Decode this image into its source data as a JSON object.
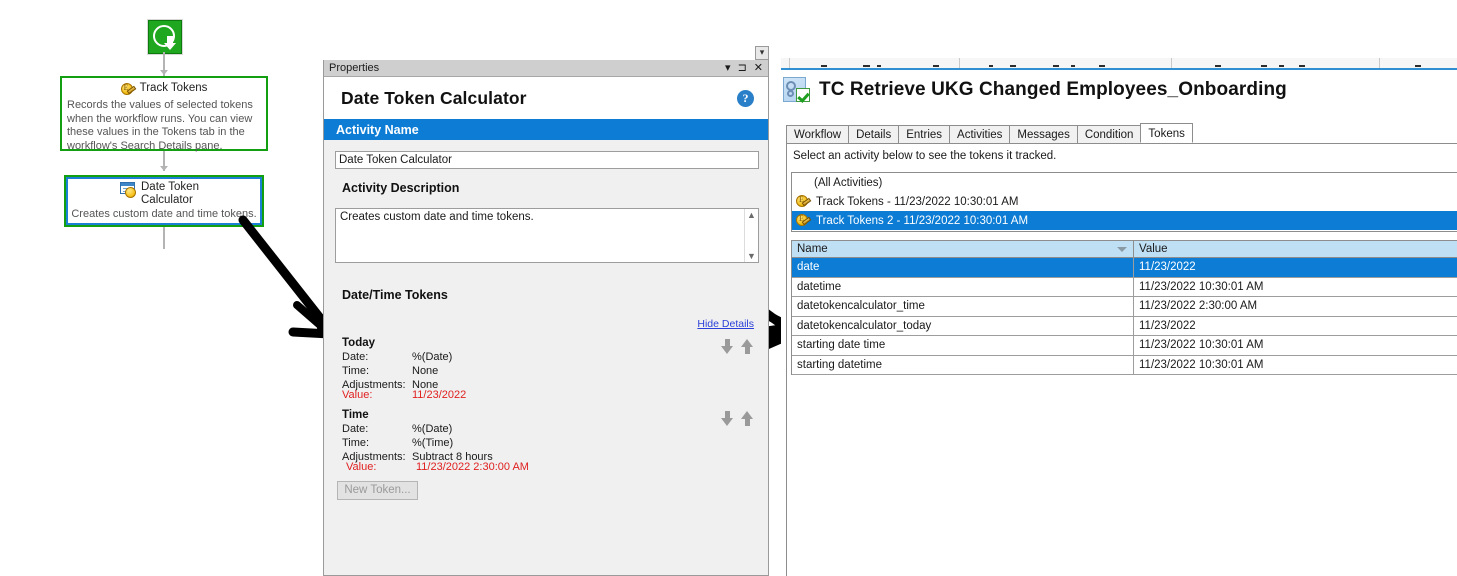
{
  "workflow": {
    "start_icon": "download-arrow-icon",
    "nodes": [
      {
        "icon": "track-tokens-icon",
        "title": "Track Tokens",
        "description": "Records the values of selected tokens when the workflow runs. You can view these values in the Tokens tab in the workflow's Search Details pane.",
        "selected": false
      },
      {
        "icon": "date-token-calculator-icon",
        "title": "Date Token\nCalculator",
        "title_line1": "Date Token",
        "title_line2": "Calculator",
        "description": "Creates custom date and time tokens.",
        "selected": true
      }
    ]
  },
  "properties": {
    "panel_title": "Properties",
    "titlebar_buttons": [
      "dropdown",
      "pin",
      "close"
    ],
    "heading": "Date Token Calculator",
    "help_icon": "help-circle-icon",
    "section_activity_name": "Activity Name",
    "activity_name_value": "Date Token Calculator",
    "section_activity_description": "Activity Description",
    "activity_description_value": "Creates custom date and time tokens.",
    "section_datetime_tokens": "Date/Time Tokens",
    "hide_details_link": "Hide Details",
    "tokens": [
      {
        "name": "Today",
        "date_label": "Date:",
        "date_value": "%(Date)",
        "time_label": "Time:",
        "time_value": "None",
        "adjustments_label": "Adjustments:",
        "adjustments_value": "None",
        "value_label": "Value:",
        "value_value": "11/23/2022"
      },
      {
        "name": "Time",
        "date_label": "Date:",
        "date_value": "%(Date)",
        "time_label": "Time:",
        "time_value": "%(Time)",
        "adjustments_label": "Adjustments:",
        "adjustments_value": "Subtract 8 hours",
        "value_label": "Value:",
        "value_value": "11/23/2022 2:30:00  AM"
      }
    ],
    "new_token_button": "New Token..."
  },
  "right_panel": {
    "app_icon": "workflow-check-icon",
    "title": "TC Retrieve UKG Changed Employees_Onboarding",
    "tabs": [
      {
        "label": "Workflow",
        "active": false
      },
      {
        "label": "Details",
        "active": false
      },
      {
        "label": "Entries",
        "active": false
      },
      {
        "label": "Activities",
        "active": false
      },
      {
        "label": "Messages",
        "active": false
      },
      {
        "label": "Condition",
        "active": false
      },
      {
        "label": "Tokens",
        "active": true
      }
    ],
    "hint": "Select an activity below to see the tokens it tracked.",
    "activities": [
      {
        "icon": "",
        "label": "(All Activities)",
        "selected": false
      },
      {
        "icon": "track-tokens-icon",
        "label": "Track Tokens - 11/23/2022 10:30:01 AM",
        "selected": false
      },
      {
        "icon": "track-tokens-icon",
        "label": "Track Tokens 2 - 11/23/2022 10:30:01 AM",
        "selected": true
      }
    ],
    "grid": {
      "columns": [
        "Name",
        "Value"
      ],
      "sort_indicator": "sort-descending-caret",
      "rows": [
        {
          "name": "date",
          "value": "11/23/2022",
          "selected": true
        },
        {
          "name": "datetime",
          "value": "11/23/2022 10:30:01 AM",
          "selected": false
        },
        {
          "name": "datetokencalculator_time",
          "value": "11/23/2022 2:30:00 AM",
          "selected": false
        },
        {
          "name": "datetokencalculator_today",
          "value": "11/23/2022",
          "selected": false
        },
        {
          "name": "starting date time",
          "value": "11/23/2022 10:30:01 AM",
          "selected": false
        },
        {
          "name": "starting datetime",
          "value": "11/23/2022 10:30:01 AM",
          "selected": false
        }
      ]
    }
  },
  "colors": {
    "accent_blue": "#0c7cd5",
    "node_green": "#12a012",
    "selection_blue": "#1b7fd4",
    "value_red": "#e02020",
    "link_blue": "#2b40d8",
    "grid_header_blue": "#bfdff5"
  }
}
